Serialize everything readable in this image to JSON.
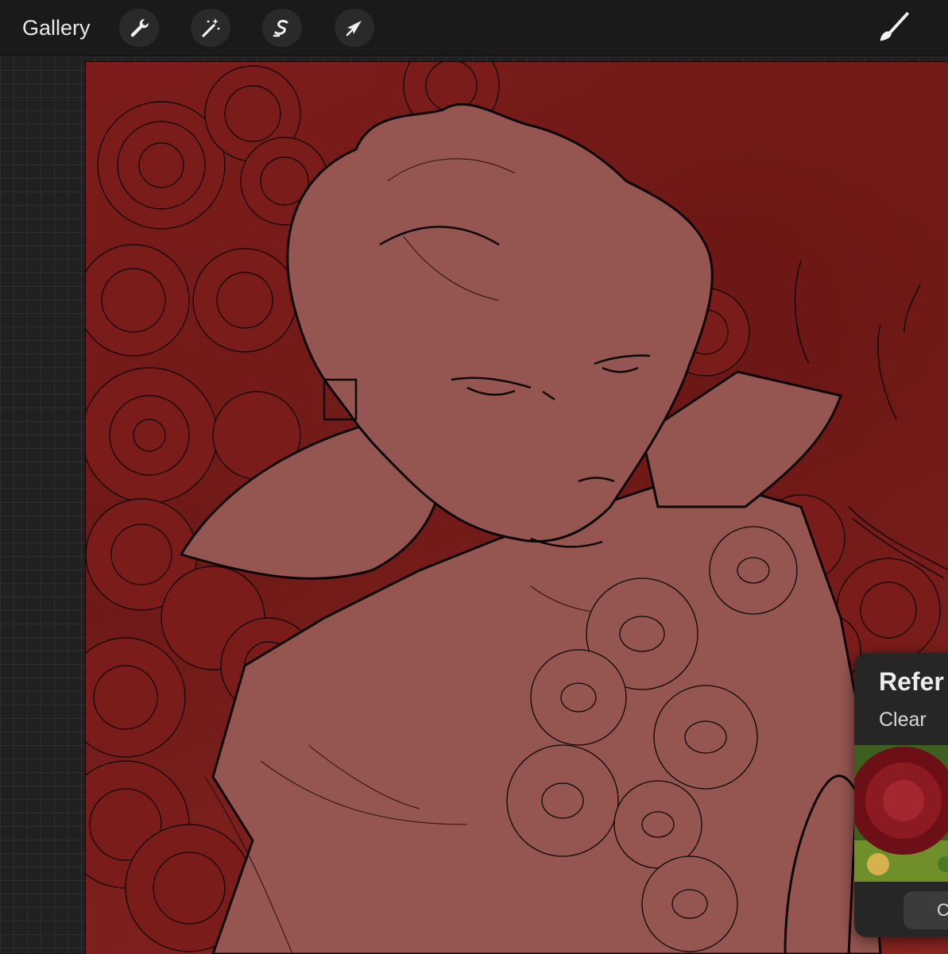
{
  "toolbar": {
    "gallery_label": "Gallery",
    "tools": [
      {
        "name": "wrench-icon"
      },
      {
        "name": "magic-wand-icon"
      },
      {
        "name": "selection-icon"
      },
      {
        "name": "transform-arrow-icon"
      }
    ],
    "brush_icon": "brush-icon"
  },
  "reference_panel": {
    "title": "Refer",
    "clear_label": "Clear",
    "button_label": "C"
  },
  "colors": {
    "background_red": "#7c1c1a",
    "figure_fill": "#955550",
    "line": "#0d0606"
  }
}
